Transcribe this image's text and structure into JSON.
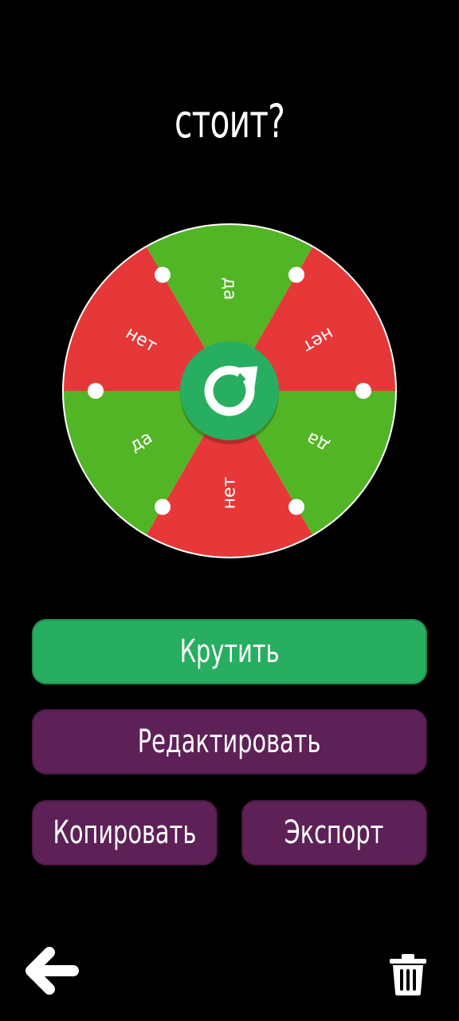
{
  "title": "стоит?",
  "wheel": {
    "segments": [
      {
        "label": "да",
        "color": "#52b526"
      },
      {
        "label": "нет",
        "color": "#e63838"
      },
      {
        "label": "да",
        "color": "#52b526"
      },
      {
        "label": "нет",
        "color": "#e63838"
      },
      {
        "label": "да",
        "color": "#52b526"
      },
      {
        "label": "нет",
        "color": "#e63838"
      }
    ],
    "center_color": "#27ae60"
  },
  "buttons": {
    "spin": "Крутить",
    "edit": "Редактировать",
    "copy": "Копировать",
    "export": "Экспорт"
  },
  "nav": {
    "back_icon": "arrow-left-icon",
    "delete_icon": "trash-icon"
  },
  "colors": {
    "background": "#000000",
    "spin_button": "#27ae60",
    "secondary_button": "#5e2157"
  }
}
